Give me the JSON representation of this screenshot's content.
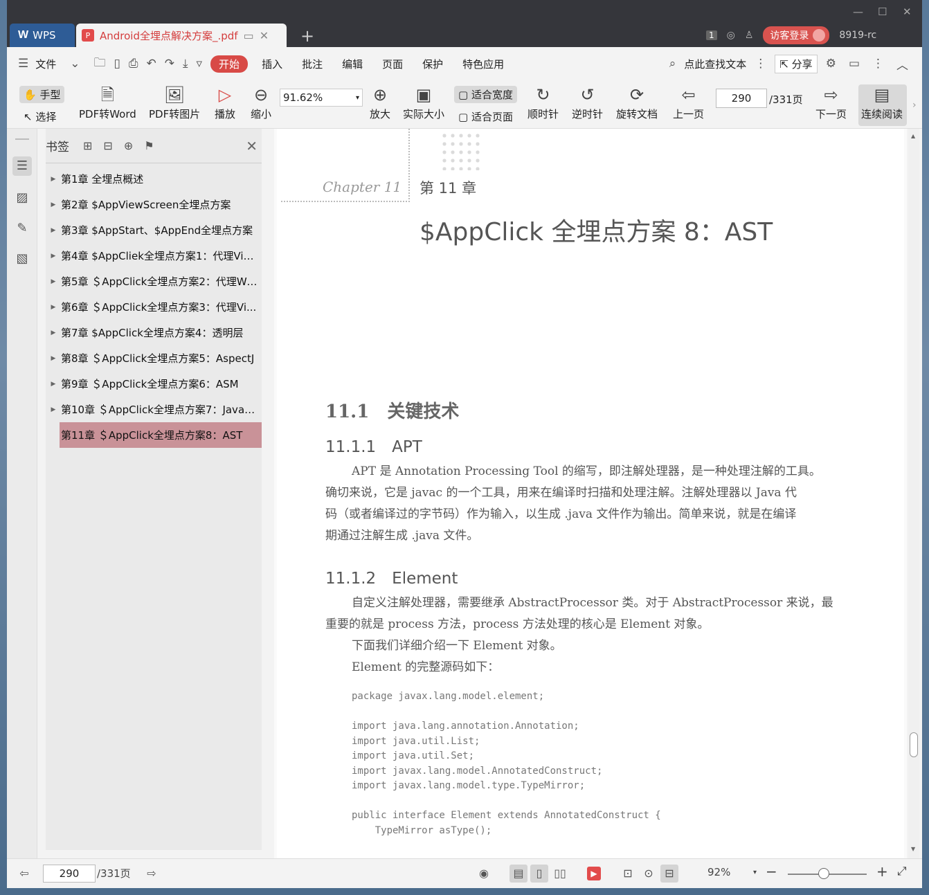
{
  "titlebar": {
    "app_name": "WPS",
    "doc_tab_title": "Android全埋点解决方案_.pdf",
    "page_badge": "1",
    "login_label": "访客登录",
    "user_name": "8919-rc"
  },
  "menubar": {
    "file_label": "文件",
    "items": [
      "开始",
      "插入",
      "批注",
      "编辑",
      "页面",
      "保护",
      "特色应用"
    ],
    "search_label": "点此查找文本",
    "share_label": "分享"
  },
  "toolbar": {
    "hand_label": "手型",
    "select_label": "选择",
    "pdf_to_word": "PDF转Word",
    "pdf_to_image": "PDF转图片",
    "play": "播放",
    "zoom_out": "缩小",
    "zoom_value": "91.62%",
    "zoom_in": "放大",
    "actual_size": "实际大小",
    "fit_width": "适合宽度",
    "fit_page": "适合页面",
    "clockwise": "顺时针",
    "counterclockwise": "逆时针",
    "rotate_doc": "旋转文档",
    "prev_page": "上一页",
    "page_current": "290",
    "page_total": "/331页",
    "next_page": "下一页",
    "continuous_read": "连续阅读"
  },
  "bookmarks": {
    "title": "书签",
    "items": [
      "第1章 全埋点概述",
      "第2章 $AppViewScreen全埋点方案",
      "第3章 $AppStart、$AppEnd全埋点方案",
      "第4章 $AppCliek全埋点方案1：代理Vie...",
      "第5章 ＄AppClick全埋点方案2：代理Wi...",
      "第6章 ＄AppClick全埋点方案3：代理Vi...",
      "第7章 $AppClick全埋点方案4：透明层",
      "第8章 ＄AppClick全埋点方案5：AspectJ",
      "第9章 ＄AppClick全埋点方案6：ASM",
      "第10章 ＄AppClick全埋点方案7：Javas...",
      "第11章 ＄AppClick全埋点方案8：AST"
    ]
  },
  "document": {
    "chapter_script": "Chapter 11",
    "chapter_num": "第 11 章",
    "chapter_title": "$AppClick 全埋点方案 8：AST",
    "sec_11_1": "11.1　关键技术",
    "sec_11_1_1": "11.1.1　APT",
    "apt_para": [
      "APT 是 Annotation Processing Tool 的缩写，即注解处理器，是一种处理注解的工具。",
      "确切来说，它是 javac 的一个工具，用来在编译时扫描和处理注解。注解处理器以 Java 代",
      "码（或者编译过的字节码）作为输入，以生成 .java 文件作为输出。简单来说，就是在编译",
      "期通过注解生成 .java 文件。"
    ],
    "sec_11_1_2": "11.1.2　Element",
    "element_para": [
      "自定义注解处理器，需要继承 AbstractProcessor 类。对于 AbstractProcessor 来说，最",
      "重要的就是 process 方法，process 方法处理的核心是 Element 对象。"
    ],
    "intro_line": "下面我们详细介绍一下 Element 对象。",
    "source_line": "Element 的完整源码如下：",
    "code": "package javax.lang.model.element;\n\nimport java.lang.annotation.Annotation;\nimport java.util.List;\nimport java.util.Set;\nimport javax.lang.model.AnnotatedConstruct;\nimport javax.lang.model.type.TypeMirror;\n\npublic interface Element extends AnnotatedConstruct {\n    TypeMirror asType();"
  },
  "statusbar": {
    "page_current": "290",
    "page_total": "/331页",
    "zoom": "92%"
  },
  "colors": {
    "accent": "#d84a46",
    "selected_bookmark": "#c99298",
    "tab_blue": "#2e5c96"
  }
}
